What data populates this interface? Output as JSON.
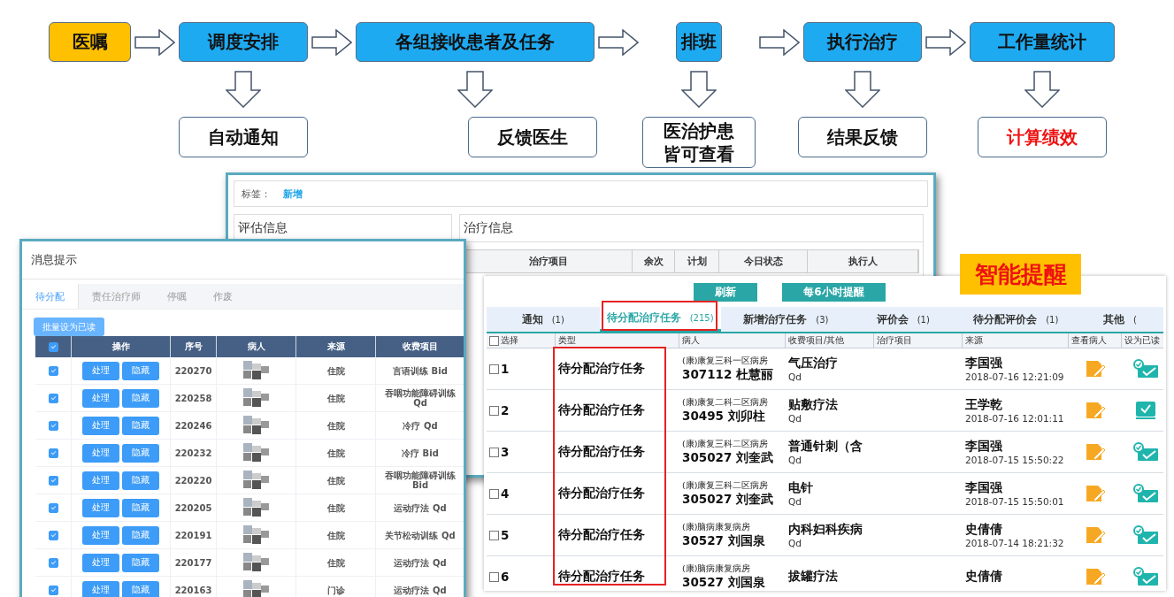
{
  "flow": {
    "steps": [
      {
        "label": "医嘱",
        "kind": "start"
      },
      {
        "label": "调度安排",
        "kind": "step",
        "outcome": {
          "label": "自动通知",
          "alert": false
        }
      },
      {
        "label": "各组接收患者及任务",
        "kind": "step",
        "outcome": {
          "label": "反馈医生",
          "alert": false
        }
      },
      {
        "label": "排班",
        "kind": "step",
        "outcome": {
          "label": "医治护患皆可查看",
          "alert": false
        }
      },
      {
        "label": "执行治疗",
        "kind": "step",
        "outcome": {
          "label": "结果反馈",
          "alert": false
        }
      },
      {
        "label": "工作量统计",
        "kind": "step",
        "outcome": {
          "label": "计算绩效",
          "alert": true
        }
      }
    ]
  },
  "detail_window": {
    "tag_label": "标签：",
    "tag_value": "新增",
    "left_panel": "评估信息",
    "right_panel": "治疗信息",
    "columns": [
      "治疗项目",
      "余次",
      "计划",
      "今日状态",
      "执行人"
    ]
  },
  "message_window": {
    "title": "消息提示",
    "tabs": [
      {
        "label": "待分配",
        "selected": true
      },
      {
        "label": "责任治疗师",
        "selected": false
      },
      {
        "label": "停嘱",
        "selected": false
      },
      {
        "label": "作废",
        "selected": false
      }
    ],
    "batch_button": "批量设为已读",
    "all_checked": true,
    "columns": [
      "操作",
      "序号",
      "病人",
      "来源",
      "收费项目"
    ],
    "rows": [
      {
        "checked": true,
        "actions": [
          "处理",
          "隐藏"
        ],
        "id": "220270",
        "source": "住院",
        "item": "言语训练 Bid"
      },
      {
        "checked": true,
        "actions": [
          "处理",
          "隐藏"
        ],
        "id": "220258",
        "source": "住院",
        "item": "吞咽功能障碍训练 Qd"
      },
      {
        "checked": true,
        "actions": [
          "处理",
          "隐藏"
        ],
        "id": "220246",
        "source": "住院",
        "item": "冷疗 Qd"
      },
      {
        "checked": true,
        "actions": [
          "处理",
          "隐藏"
        ],
        "id": "220232",
        "source": "住院",
        "item": "冷疗 Bid"
      },
      {
        "checked": true,
        "actions": [
          "处理",
          "隐藏"
        ],
        "id": "220220",
        "source": "住院",
        "item": "吞咽功能障碍训练 Bid"
      },
      {
        "checked": true,
        "actions": [
          "处理",
          "隐藏"
        ],
        "id": "220205",
        "source": "住院",
        "item": "运动疗法 Qd"
      },
      {
        "checked": true,
        "actions": [
          "处理",
          "隐藏"
        ],
        "id": "220191",
        "source": "住院",
        "item": "关节松动训练 Qd"
      },
      {
        "checked": true,
        "actions": [
          "处理",
          "隐藏"
        ],
        "id": "220177",
        "source": "住院",
        "item": "运动疗法 Qd"
      },
      {
        "checked": true,
        "actions": [
          "处理",
          "隐藏"
        ],
        "id": "220163",
        "source": "门诊",
        "item": "运动疗法 Qd"
      }
    ]
  },
  "reminder_label": "智能提醒",
  "task_window": {
    "buttons": [
      "刷新",
      "每6小时提醒"
    ],
    "all_checked": false,
    "tabs": [
      {
        "label": "通知",
        "count": "(1)",
        "selected": false
      },
      {
        "label": "待分配治疗任务",
        "count": "(215)",
        "selected": true
      },
      {
        "label": "新增治疗任务",
        "count": "(3)",
        "selected": false
      },
      {
        "label": "评价会",
        "count": "(1)",
        "selected": false
      },
      {
        "label": "待分配评价会",
        "count": "(1)",
        "selected": false
      },
      {
        "label": "其他",
        "count": "(",
        "selected": false
      }
    ],
    "columns": [
      "选择",
      "类型",
      "病人",
      "收费项目/其他",
      "治疗项目",
      "来源",
      "查看病人",
      "设为已读"
    ],
    "rows": [
      {
        "no": "1",
        "checked": false,
        "type": "待分配治疗任务",
        "ward": "(康)康复三科一区病房",
        "patient": "307112 杜慧丽",
        "item": "气压治疗",
        "freq": "Qd",
        "source": "李国强",
        "time": "2018-07-16 12:21:09",
        "read": false
      },
      {
        "no": "2",
        "checked": false,
        "type": "待分配治疗任务",
        "ward": "(康)康复二科二区病房",
        "patient": "30495 刘卯柱",
        "item": "贴敷疗法",
        "freq": "Qd",
        "source": "王学乾",
        "time": "2018-07-16 12:01:11",
        "read": true
      },
      {
        "no": "3",
        "checked": false,
        "type": "待分配治疗任务",
        "ward": "(康)康复三科二区病房",
        "patient": "305027 刘奎武",
        "item": "普通针刺（含",
        "freq": "Qd",
        "source": "李国强",
        "time": "2018-07-15 15:50:22",
        "read": false
      },
      {
        "no": "4",
        "checked": false,
        "type": "待分配治疗任务",
        "ward": "(康)康复三科二区病房",
        "patient": "305027 刘奎武",
        "item": "电针",
        "freq": "Qd",
        "source": "李国强",
        "time": "2018-07-15 15:50:01",
        "read": false
      },
      {
        "no": "5",
        "checked": false,
        "type": "待分配治疗任务",
        "ward": "(康)脑病康复病房",
        "patient": "30527 刘国泉",
        "item": "内科妇科疾病",
        "freq": "Qd",
        "source": "史倩倩",
        "time": "2018-07-14 18:21:32",
        "read": false
      },
      {
        "no": "6",
        "checked": false,
        "type": "待分配治疗任务",
        "ward": "(康)脑病康复病房",
        "patient": "30527 刘国泉",
        "item": "拔罐疗法",
        "source": "史倩倩",
        "read": false
      }
    ]
  }
}
